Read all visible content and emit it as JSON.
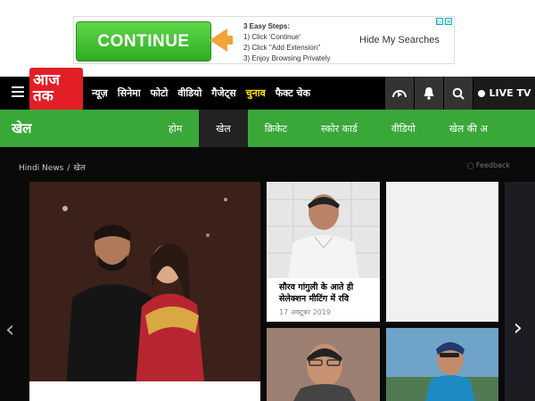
{
  "ad": {
    "button_label": "CONTINUE",
    "steps_heading": "3 Easy Steps:",
    "steps": [
      "1) Click 'Continue'",
      "2) Click \"Add Extension\"",
      "3) Enjoy Browsing Privately"
    ],
    "hide_text": "Hide My Searches",
    "adchoices": [
      "▷",
      "✕"
    ]
  },
  "topnav": {
    "logo_text_line1": "आज",
    "logo_text_line2": "तक",
    "links": [
      {
        "label": "न्यूज़"
      },
      {
        "label": "सिनेमा"
      },
      {
        "label": "फोटो"
      },
      {
        "label": "वीडियो"
      },
      {
        "label": "गैजेट्स"
      },
      {
        "label": "चुनाव",
        "highlight": true
      },
      {
        "label": "फैक्ट चेक"
      }
    ],
    "live_tv": "LIVE TV",
    "icons": [
      "audio-icon",
      "bell-icon",
      "search-icon"
    ]
  },
  "sports": {
    "title": "खेल",
    "tabs": [
      {
        "label": "होम"
      },
      {
        "label": "खेल",
        "active": true
      },
      {
        "label": "क्रिकेट"
      },
      {
        "label": "स्कोर कार्ड"
      },
      {
        "label": "वीडियो"
      },
      {
        "label": "खेल की अ"
      }
    ]
  },
  "breadcrumb": {
    "home": "Hindi News",
    "separator": "/",
    "current": "खेल",
    "feedback": "Feedback"
  },
  "cards": [
    {
      "title": "सौरव गांगुली के आते ही सेलेक्शन मीटिंग में रवि",
      "date": "17 अक्टूबर 2019"
    }
  ],
  "nav_arrows": {
    "prev": "‹",
    "next": "›"
  }
}
